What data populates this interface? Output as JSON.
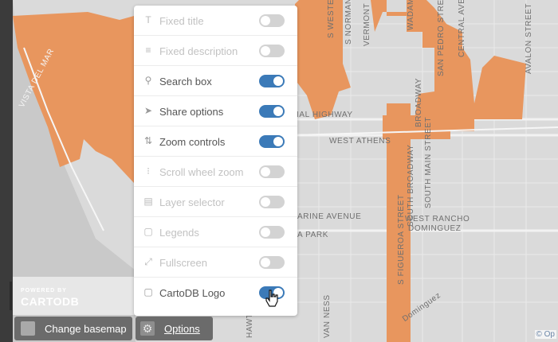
{
  "map": {
    "labels": [
      {
        "key": "vista",
        "text": "VISTA DEL MAR"
      },
      {
        "key": "normandie",
        "text": "S NORMANDIE"
      },
      {
        "key": "western",
        "text": "S WESTERN"
      },
      {
        "key": "vermont",
        "text": "VERMONT"
      },
      {
        "key": "pedro",
        "text": "SAN PEDRO STREET"
      },
      {
        "key": "central",
        "text": "CENTRAL AVENUE"
      },
      {
        "key": "avalon",
        "text": "AVALON STREET"
      },
      {
        "key": "wadams",
        "text": "WADAMS"
      },
      {
        "key": "highway",
        "text": "IAL HIGHWAY"
      },
      {
        "key": "athens",
        "text": "WEST ATHENS"
      },
      {
        "key": "broadway",
        "text": "BROADWAY"
      },
      {
        "key": "sbroadway",
        "text": "SOUTH BROADWAY"
      },
      {
        "key": "mainst",
        "text": "SOUTH MAIN STREET"
      },
      {
        "key": "rancho1",
        "text": "WEST RANCHO"
      },
      {
        "key": "rancho2",
        "text": "DOMINGUEZ"
      },
      {
        "key": "marine",
        "text": "ARINE AVENUE"
      },
      {
        "key": "park",
        "text": "A PARK"
      },
      {
        "key": "figueroa",
        "text": "S FIGUEROA STREET"
      },
      {
        "key": "vanness",
        "text": "VAN NESS"
      },
      {
        "key": "hawth",
        "text": "HAWTH"
      },
      {
        "key": "dominguez",
        "text": "Dominguez"
      }
    ],
    "attribution": "© Op",
    "colors": {
      "water": "#c9c9c9",
      "land": "#dadada",
      "orange": "#e8965e"
    }
  },
  "panel": {
    "items": [
      {
        "name": "fixed-title",
        "label": "Fixed title",
        "icon": "T",
        "on": false
      },
      {
        "name": "fixed-description",
        "label": "Fixed description",
        "icon": "≡",
        "on": false
      },
      {
        "name": "search-box",
        "label": "Search box",
        "icon": "⚲",
        "on": true
      },
      {
        "name": "share-options",
        "label": "Share options",
        "icon": "➤",
        "on": true
      },
      {
        "name": "zoom-controls",
        "label": "Zoom controls",
        "icon": "⇅",
        "on": true
      },
      {
        "name": "scroll-wheel-zoom",
        "label": "Scroll wheel zoom",
        "icon": "⁝",
        "on": false
      },
      {
        "name": "layer-selector",
        "label": "Layer selector",
        "icon": "▤",
        "on": false
      },
      {
        "name": "legends",
        "label": "Legends",
        "icon": "▢",
        "on": false
      },
      {
        "name": "fullscreen",
        "label": "Fullscreen",
        "icon": "⤢",
        "on": false
      },
      {
        "name": "cartodb-logo",
        "label": "CartoDB Logo",
        "icon": "▢",
        "on": true
      }
    ]
  },
  "logo": {
    "powered": "POWERED BY",
    "brand": "CARTODB"
  },
  "buttons": {
    "basemap": "Change basemap",
    "options": "Options"
  }
}
